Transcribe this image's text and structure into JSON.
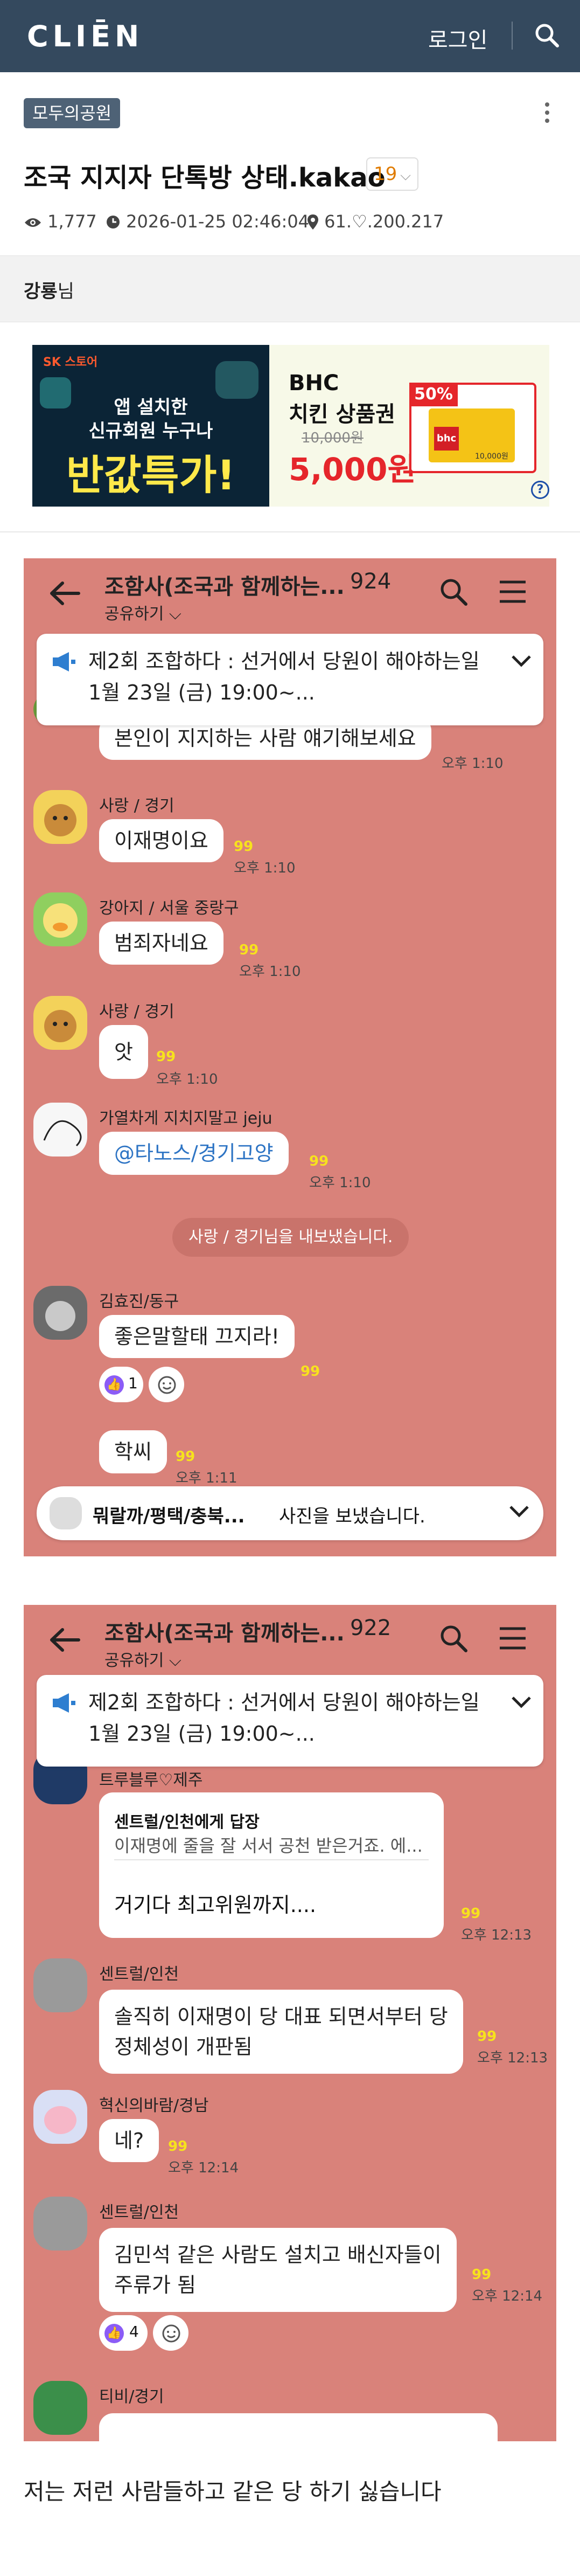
{
  "header": {
    "logo": "CLIĒN",
    "login": "로그인"
  },
  "post": {
    "board": "모두의공원",
    "title": "조국 지지자 단톡방 상태.kakao",
    "comment_count": "19",
    "views": "1,777",
    "datetime": "2026-01-25 02:46:04",
    "ip": "61.♡.200.217",
    "author": "강룡",
    "author_suffix": "님",
    "body": "저는 저런 사람들하고 같은 당 하기 싫습니다"
  },
  "ad": {
    "brand": "SK 스토어",
    "line1": "앱 설치한",
    "line2": "신규회원 누구나",
    "headline": "반값특가!",
    "product": "BHC",
    "product2": "치킨 상품권",
    "old_price": "10,000원",
    "new_price": "5,000원",
    "discount": "50%",
    "card_brand": "bhc",
    "card_price": "10,000원",
    "info": "?"
  },
  "shot1": {
    "room_title": "조함사(조국과 함께하는...",
    "count": "924",
    "share": "공유하기",
    "notice_line1": "제2회 조합하다 : 선거에서 당원이 해야하는일",
    "notice_line2": "1월 23일 (금) 19:00~...",
    "messages": [
      {
        "text": "본인이 지지하는 사람 얘기해보세요",
        "time": "오후 1:10"
      },
      {
        "sender": "사랑 / 경기",
        "text": "이재명이요",
        "unread": "99",
        "time": "오후 1:10"
      },
      {
        "sender": "강아지 / 서울 중랑구",
        "text": "범죄자네요",
        "unread": "99",
        "time": "오후 1:10"
      },
      {
        "sender": "사랑 / 경기",
        "text": "앗",
        "unread": "99",
        "time": "오후 1:10"
      },
      {
        "sender": "가열차게 지치지말고 jeju",
        "text": "@타노스/경기고양",
        "unread": "99",
        "time": "오후 1:10"
      },
      {
        "sender": "김효진/동구",
        "text": "좋은말할태 끄지라!",
        "unread": "99",
        "react_count": "1"
      },
      {
        "text": "학씨",
        "unread": "99",
        "time": "오후 1:11"
      }
    ],
    "system": "사랑 / 경기님을 내보냈습니다.",
    "toast_sender": "뭐랄까/평택/충북...",
    "toast_text": "사진을 보냈습니다."
  },
  "shot2": {
    "room_title": "조함사(조국과 함께하는...",
    "count": "922",
    "share": "공유하기",
    "notice_line1": "제2회 조합하다 : 선거에서 당원이 해야하는일",
    "notice_line2": "1월 23일 (금) 19:00~...",
    "messages": [
      {
        "sender": "트루블루♡제주",
        "reply_to": "센트럴/인천에게 답장",
        "quote": "이재명에 줄을 잘 서서 공천 받은거죠. 에...",
        "text": "거기다 최고위원까지....",
        "unread": "99",
        "time": "오후 12:13"
      },
      {
        "sender": "센트럴/인천",
        "line1": "솔직히 이재명이 당 대표 되면서부터 당",
        "line2": "정체성이 개판됨",
        "unread": "99",
        "time": "오후 12:13"
      },
      {
        "sender": "혁신의바람/경남",
        "text": "네?",
        "unread": "99",
        "time": "오후 12:14"
      },
      {
        "sender": "센트럴/인천",
        "line1": "김민석 같은 사람도 설치고 배신자들이",
        "line2": "주류가 됨",
        "unread": "99",
        "time": "오후 12:14",
        "react_count": "4"
      },
      {
        "sender": "티비/경기"
      }
    ]
  },
  "colors": {
    "header": "#34495e",
    "chat_bg": "#d9827a",
    "badge": "#4e6276",
    "unread": "#f7e21d"
  }
}
